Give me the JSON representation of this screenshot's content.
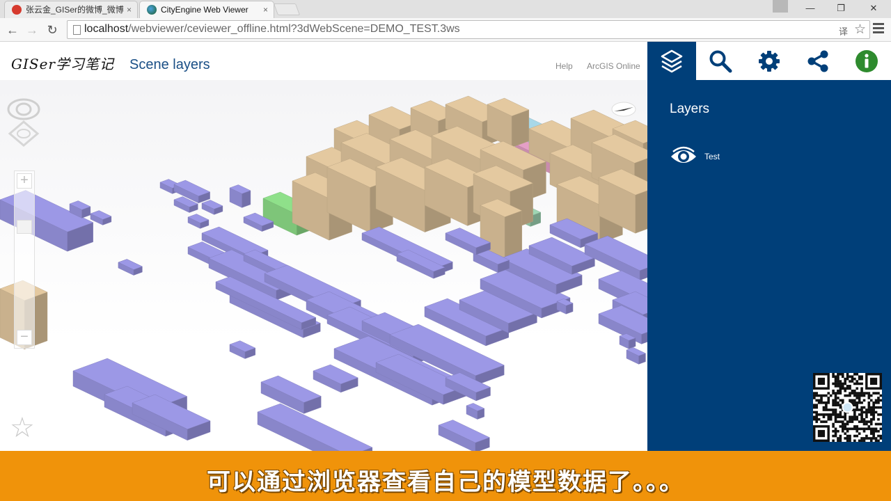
{
  "browser": {
    "tabs": [
      {
        "title": "张云金_GISer的微博_微博",
        "close": "×"
      },
      {
        "title": "CityEngine Web Viewer",
        "close": "×"
      }
    ],
    "window_controls": {
      "minimize": "—",
      "restore": "❐",
      "close": "✕"
    },
    "nav": {
      "back": "←",
      "forward": "→",
      "reload": "↻"
    },
    "url": {
      "host": "localhost",
      "path": "/webviewer/ceviewer_offline.html?3dWebScene=DEMO_TEST.3ws"
    },
    "omnibox_icons": {
      "translate": "译",
      "bookmark": "☆"
    }
  },
  "app": {
    "logo": "GISer学习笔记",
    "scene_title": "Scene layers",
    "links": {
      "help": "Help",
      "arcgis_online": "ArcGIS Online"
    }
  },
  "viewport": {
    "zoom_in": "+",
    "zoom_out": "−",
    "bookmark_star": "☆"
  },
  "panel": {
    "tabs": [
      {
        "name": "layers",
        "icon": "layers-icon",
        "active": true
      },
      {
        "name": "search",
        "icon": "search-icon",
        "active": false
      },
      {
        "name": "settings",
        "icon": "gear-icon",
        "active": false
      },
      {
        "name": "share",
        "icon": "share-icon",
        "active": false
      },
      {
        "name": "info",
        "icon": "info-icon",
        "active": false
      }
    ],
    "heading": "Layers",
    "layers": [
      {
        "name": "Test",
        "visible": true
      }
    ]
  },
  "subtitle": "可以通过浏览器查看自己的模型数据了。。。",
  "colors": {
    "panel_bg": "#003f79",
    "subtitle_bar": "#f0930a",
    "building_purple": "#9c98e6",
    "building_tan": "#e4c9a0",
    "building_green": "#8fe08a",
    "building_pink": "#e49fc6",
    "building_blue": "#a8d8e8",
    "info_green": "#2e8b2e"
  }
}
